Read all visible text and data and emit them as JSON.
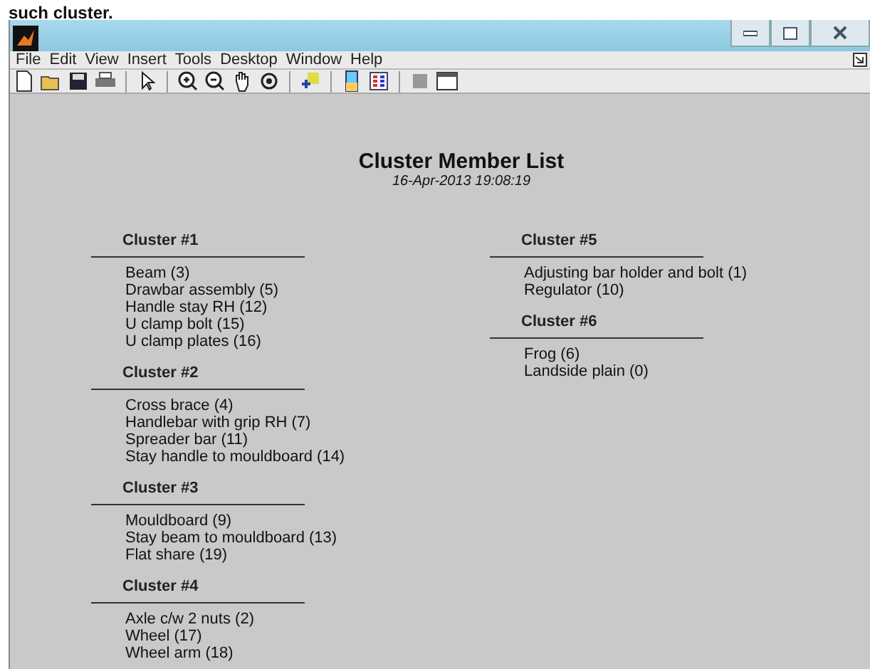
{
  "page_text": "such cluster.",
  "window": {
    "menu": [
      "File",
      "Edit",
      "View",
      "Insert",
      "Tools",
      "Desktop",
      "Window",
      "Help"
    ]
  },
  "figure": {
    "title": "Cluster Member List",
    "date": "16-Apr-2013 19:08:19",
    "columns": [
      [
        {
          "heading": "Cluster #1",
          "members": [
            "Beam (3)",
            "Drawbar assembly (5)",
            "Handle stay RH (12)",
            "U clamp bolt (15)",
            "U clamp plates (16)"
          ]
        },
        {
          "heading": "Cluster #2",
          "members": [
            "Cross brace (4)",
            "Handlebar with grip RH (7)",
            "Spreader bar (11)",
            "Stay handle to mouldboard (14)"
          ]
        },
        {
          "heading": "Cluster #3",
          "members": [
            "Mouldboard (9)",
            "Stay beam to mouldboard (13)",
            "Flat share (19)"
          ]
        },
        {
          "heading": "Cluster #4",
          "members": [
            "Axle c/w 2 nuts (2)",
            "Wheel (17)",
            "Wheel arm (18)"
          ]
        }
      ],
      [
        {
          "heading": "Cluster #5",
          "members": [
            "Adjusting bar holder and bolt (1)",
            "Regulator (10)"
          ]
        },
        {
          "heading": "Cluster #6",
          "members": [
            "Frog (6)",
            "Landside plain (0)"
          ]
        }
      ]
    ]
  }
}
